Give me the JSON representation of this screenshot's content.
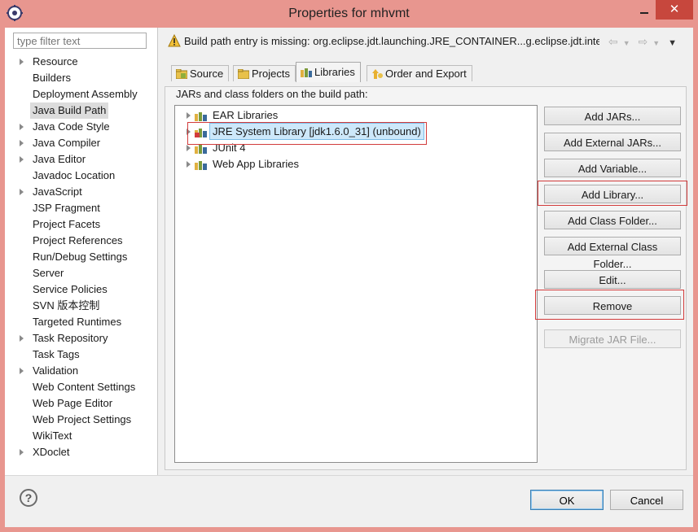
{
  "window": {
    "title": "Properties for mhvmt",
    "close_glyph": "✕",
    "accent": "#e8968f",
    "close_color": "#c7473d"
  },
  "left": {
    "filter_placeholder": "type filter text",
    "items": [
      {
        "label": "Resource",
        "expandable": true
      },
      {
        "label": "Builders",
        "expandable": false
      },
      {
        "label": "Deployment Assembly",
        "expandable": false
      },
      {
        "label": "Java Build Path",
        "expandable": false,
        "selected": true
      },
      {
        "label": "Java Code Style",
        "expandable": true
      },
      {
        "label": "Java Compiler",
        "expandable": true
      },
      {
        "label": "Java Editor",
        "expandable": true
      },
      {
        "label": "Javadoc Location",
        "expandable": false
      },
      {
        "label": "JavaScript",
        "expandable": true
      },
      {
        "label": "JSP Fragment",
        "expandable": false
      },
      {
        "label": "Project Facets",
        "expandable": false
      },
      {
        "label": "Project References",
        "expandable": false
      },
      {
        "label": "Run/Debug Settings",
        "expandable": false
      },
      {
        "label": "Server",
        "expandable": false
      },
      {
        "label": "Service Policies",
        "expandable": false
      },
      {
        "label": "SVN 版本控制",
        "expandable": false
      },
      {
        "label": "Targeted Runtimes",
        "expandable": false
      },
      {
        "label": "Task Repository",
        "expandable": true
      },
      {
        "label": "Task Tags",
        "expandable": false
      },
      {
        "label": "Validation",
        "expandable": true
      },
      {
        "label": "Web Content Settings",
        "expandable": false
      },
      {
        "label": "Web Page Editor",
        "expandable": false
      },
      {
        "label": "Web Project Settings",
        "expandable": false
      },
      {
        "label": "WikiText",
        "expandable": false
      },
      {
        "label": "XDoclet",
        "expandable": true
      }
    ]
  },
  "message": {
    "text": "Build path entry is missing: org.eclipse.jdt.launching.JRE_CONTAINER...g.eclipse.jdt.intern",
    "icon": "warning-icon"
  },
  "tabs": [
    {
      "label": "Source",
      "icon": "source-folder-icon"
    },
    {
      "label": "Projects",
      "icon": "project-icon"
    },
    {
      "label": "Libraries",
      "icon": "library-icon",
      "active": true
    },
    {
      "label": "Order and Export",
      "icon": "order-export-icon"
    }
  ],
  "libraries": {
    "heading": "JARs and class folders on the build path:",
    "items": [
      {
        "label": "EAR Libraries"
      },
      {
        "label": "JRE System Library [jdk1.6.0_31] (unbound)",
        "selected": true,
        "error": true
      },
      {
        "label": "JUnit 4"
      },
      {
        "label": "Web App Libraries"
      }
    ]
  },
  "buttons": {
    "add_jars": "Add JARs...",
    "add_external_jars": "Add External JARs...",
    "add_variable": "Add Variable...",
    "add_library": "Add Library...",
    "add_class_folder": "Add Class Folder...",
    "add_external_class_folder": "Add External Class Folder...",
    "edit": "Edit...",
    "remove": "Remove",
    "migrate_jar": "Migrate JAR File..."
  },
  "dialog": {
    "ok": "OK",
    "cancel": "Cancel",
    "help_glyph": "?"
  },
  "highlight_color": "#d23c3c"
}
